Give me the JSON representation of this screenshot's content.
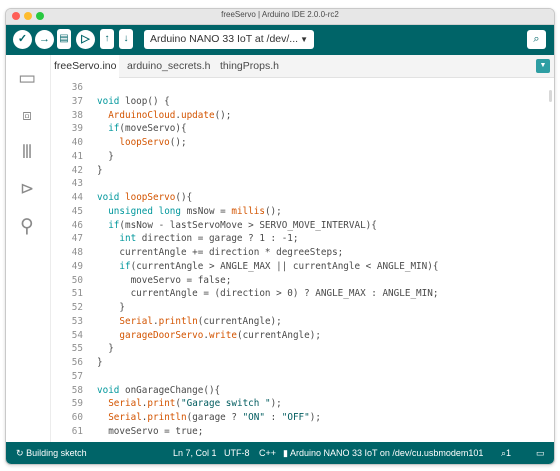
{
  "window": {
    "title": "freeServo | Arduino IDE 2.0.0-rc2"
  },
  "colors": {
    "toolbar": "#006468",
    "close": "#fe5f57",
    "minimize": "#febc2e",
    "maximize": "#28c840",
    "keyword": "#00979c",
    "function": "#d35400"
  },
  "toolbar": {
    "verify_icon": "check-icon",
    "upload_icon": "arrow-right-icon",
    "new_icon": "file-icon",
    "debug_icon": "debug-icon",
    "open_icon": "arrow-up-icon",
    "save_icon": "arrow-down-icon",
    "board": "Arduino NANO 33 IoT at /dev/...",
    "serial_icon": "serial-monitor-icon"
  },
  "sidebar": {
    "icons": [
      "folder-icon",
      "board-icon",
      "library-icon",
      "debug-icon",
      "search-icon"
    ]
  },
  "tabs": [
    {
      "label": "freeServo.ino"
    },
    {
      "label": "arduino_secrets.h"
    },
    {
      "label": "thingProps.h"
    }
  ],
  "code_lines": [
    {
      "n": "36",
      "text": ""
    },
    {
      "n": "37",
      "text": "void loop() {"
    },
    {
      "n": "38",
      "text": "  ArduinoCloud.update();"
    },
    {
      "n": "39",
      "text": "  if(moveServo){"
    },
    {
      "n": "40",
      "text": "    loopServo();"
    },
    {
      "n": "41",
      "text": "  }"
    },
    {
      "n": "42",
      "text": "}"
    },
    {
      "n": "43",
      "text": ""
    },
    {
      "n": "44",
      "text": "void loopServo(){"
    },
    {
      "n": "45",
      "text": "  unsigned long msNow = millis();"
    },
    {
      "n": "46",
      "text": "  if(msNow - lastServoMove > SERVO_MOVE_INTERVAL){"
    },
    {
      "n": "47",
      "text": "    int direction = garage ? 1 : -1;"
    },
    {
      "n": "48",
      "text": "    currentAngle += direction * degreeSteps;"
    },
    {
      "n": "49",
      "text": "    if(currentAngle > ANGLE_MAX || currentAngle < ANGLE_MIN){"
    },
    {
      "n": "50",
      "text": "      moveServo = false;"
    },
    {
      "n": "51",
      "text": "      currentAngle = (direction > 0) ? ANGLE_MAX : ANGLE_MIN;"
    },
    {
      "n": "52",
      "text": "    }"
    },
    {
      "n": "53",
      "text": "    Serial.println(currentAngle);"
    },
    {
      "n": "54",
      "text": "    garageDoorServo.write(currentAngle);"
    },
    {
      "n": "55",
      "text": "  }"
    },
    {
      "n": "56",
      "text": "}"
    },
    {
      "n": "57",
      "text": ""
    },
    {
      "n": "58",
      "text": "void onGarageChange(){"
    },
    {
      "n": "59",
      "text": "  Serial.print(\"Garage switch \");"
    },
    {
      "n": "60",
      "text": "  Serial.println(garage ? \"ON\" : \"OFF\");"
    },
    {
      "n": "61",
      "text": "  moveServo = true;"
    }
  ],
  "status": {
    "building": "Building sketch",
    "cursor": "Ln 7, Col 1",
    "encoding": "UTF-8",
    "language": "C++",
    "board": "Arduino NANO 33 IoT on /dev/cu.usbmodem101",
    "notifications": "1"
  }
}
